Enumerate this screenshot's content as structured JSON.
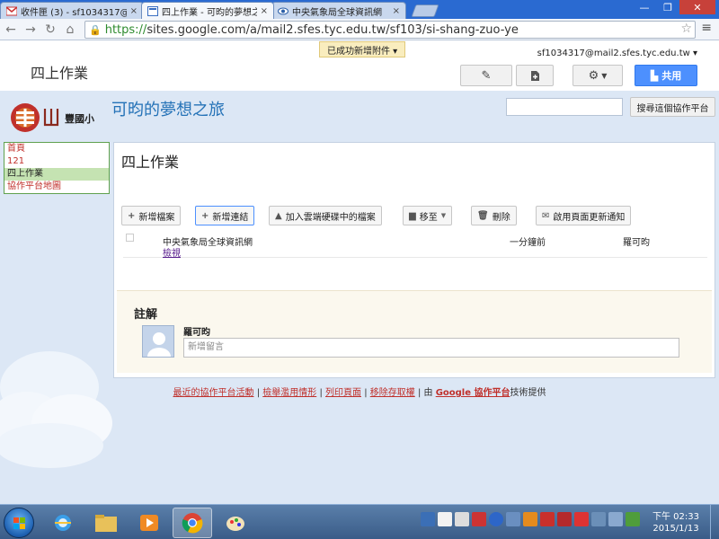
{
  "browser": {
    "tabs": [
      {
        "title": "收件匣 (3) - sf1034317@",
        "icon": "gmail-icon"
      },
      {
        "title": "四上作業 - 可昀的夢想之旅",
        "icon": "sites-icon"
      },
      {
        "title": "中央氣象局全球資訊網",
        "icon": "eye-icon"
      }
    ],
    "url_scheme": "https://",
    "url_rest": "sites.google.com/a/mail2.sfes.tyc.edu.tw/sf103/si-shang-zuo-ye"
  },
  "header": {
    "page_title": "四上作業",
    "toast": "已成功新增附件 ▾",
    "user_email": "sf1034317@mail2.sfes.tyc.edu.tw ▾",
    "share_label": "共用"
  },
  "site": {
    "name": "可昀的夢想之旅",
    "logo_text": "豐國小",
    "search_button": "搜尋這個協作平台",
    "nav": [
      "首頁",
      "121",
      "四上作業",
      "協作平台地圖"
    ]
  },
  "page": {
    "title": "四上作業",
    "actions": {
      "add_file": "新增檔案",
      "add_link": "新增連結",
      "add_drive": "加入雲端硬碟中的檔案",
      "move_to": "移至",
      "delete": "刪除",
      "notify": "啟用頁面更新通知"
    },
    "file": {
      "name": "中央氣象局全球資訊網",
      "view": "檢視",
      "time": "一分鐘前",
      "user": "羅可昀"
    },
    "comments": {
      "title": "註解",
      "user": "羅可昀",
      "placeholder": "新增留言"
    }
  },
  "footer": {
    "recent": "最近的協作平台活動",
    "abuse": "檢舉濫用情形",
    "print": "列印頁面",
    "remove": "移除存取權",
    "by": "由",
    "google": "Google 協作平台",
    "tail": "技術提供",
    "sep": "|"
  },
  "taskbar": {
    "time": "下午 02:33",
    "date": "2015/1/13"
  }
}
